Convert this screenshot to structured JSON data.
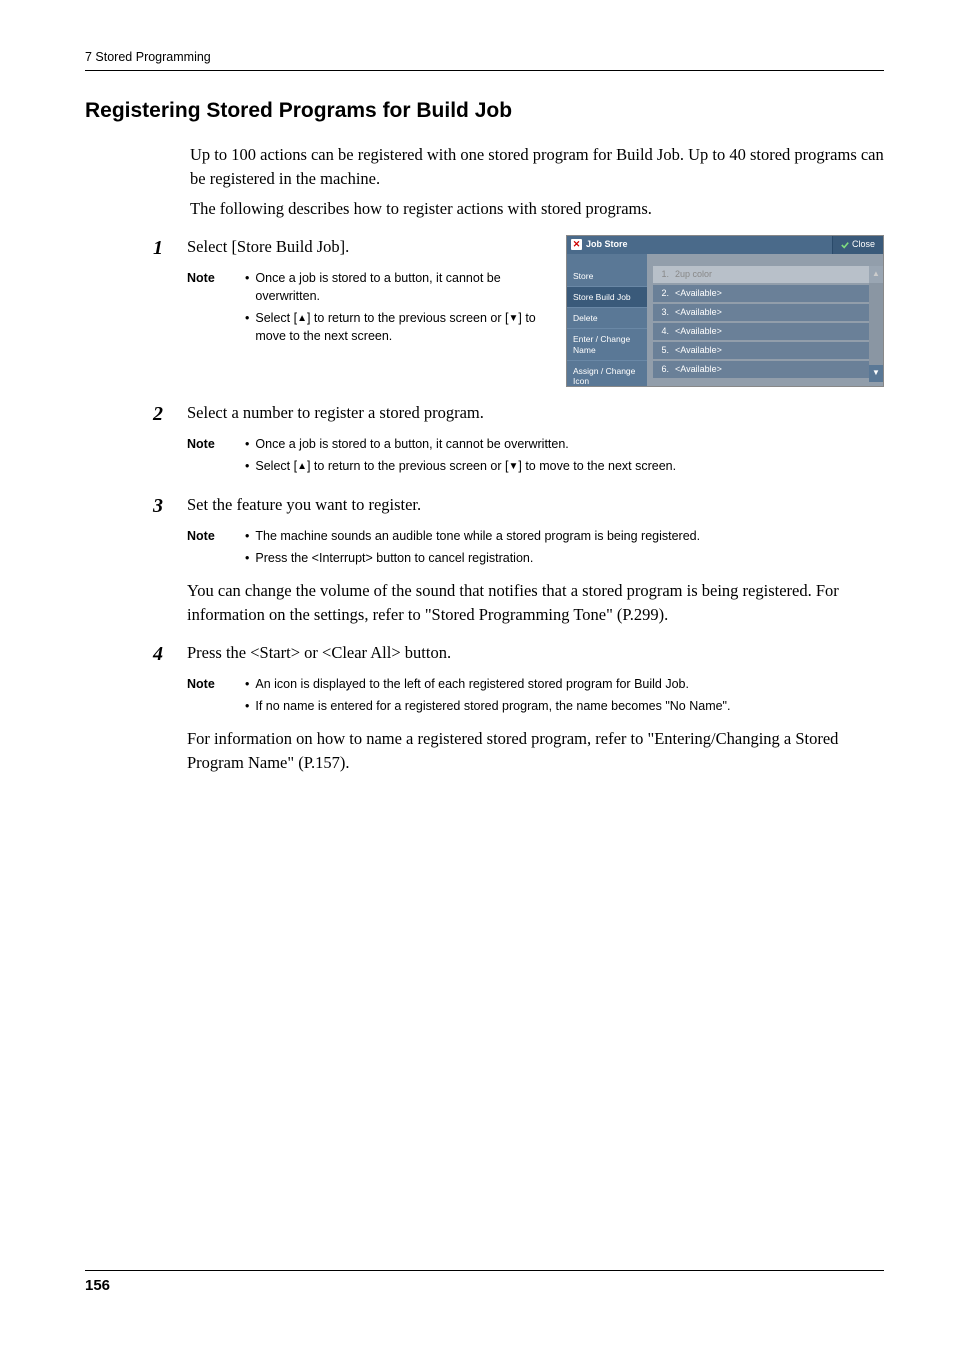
{
  "running_head": "7 Stored Programming",
  "section_title": "Registering Stored Programs for Build Job",
  "intro": {
    "p1": "Up to 100 actions can be registered with one stored program for Build Job. Up to 40 stored programs can be registered in the machine.",
    "p2": "The following describes how to register actions with stored programs."
  },
  "steps": {
    "s1": {
      "num": "1",
      "text": "Select [Store Build Job].",
      "note_label": "Note",
      "notes": {
        "a": "Once a job is stored to a button, it cannot be overwritten.",
        "b_pre": "Select [",
        "b_mid": "] to return to the previous screen or [",
        "b_post": "] to move to the next screen."
      }
    },
    "s2": {
      "num": "2",
      "text": "Select a number to register a stored program.",
      "note_label": "Note",
      "notes": {
        "a": "Once a job is stored to a button, it cannot be overwritten.",
        "b_pre": "Select [",
        "b_mid": "] to return to the previous screen or [",
        "b_post": "] to move to the next screen."
      }
    },
    "s3": {
      "num": "3",
      "text": "Set the feature you want to register.",
      "note_label": "Note",
      "notes": {
        "a": "The machine sounds an audible tone while a stored program is being registered.",
        "b": "Press the <Interrupt> button to cancel registration."
      },
      "para": "You can change the volume of the sound that notifies that a stored program is being registered. For information on the settings, refer to \"Stored Programming Tone\" (P.299)."
    },
    "s4": {
      "num": "4",
      "text": "Press the <Start> or <Clear All> button.",
      "note_label": "Note",
      "notes": {
        "a": "An icon is displayed to the left of each registered stored program for Build Job.",
        "b": "If no name is entered for a registered stored program, the name becomes \"No Name\"."
      },
      "para": "For information on how to name a registered stored program, refer to \"Entering/Changing a Stored Program Name\" (P.157)."
    }
  },
  "screenshot": {
    "title": "Job Store",
    "close": "Close",
    "sidebar": {
      "i0": "Store",
      "i1": "Store Build Job",
      "i2": "Delete",
      "i3": "Enter / Change Name",
      "i4": "Assign / Change Icon"
    },
    "rows": {
      "r1": {
        "n": "1.",
        "t": "2up color"
      },
      "r2": {
        "n": "2.",
        "t": "<Available>"
      },
      "r3": {
        "n": "3.",
        "t": "<Available>"
      },
      "r4": {
        "n": "4.",
        "t": "<Available>"
      },
      "r5": {
        "n": "5.",
        "t": "<Available>"
      },
      "r6": {
        "n": "6.",
        "t": "<Available>"
      }
    }
  },
  "page_number": "156"
}
